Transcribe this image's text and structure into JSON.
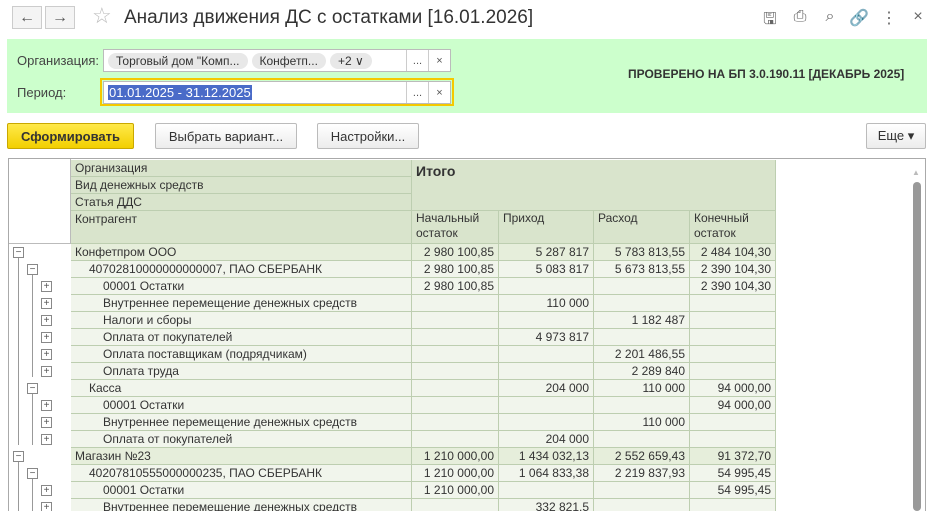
{
  "window": {
    "title": "Анализ движения ДС с остатками [16.01.2026]"
  },
  "filters": {
    "org_label": "Организация:",
    "org_chips": [
      "Торговый дом \"Комп...",
      "Конфетп...",
      "+2 ∨"
    ],
    "period_label": "Период:",
    "period_value": "01.01.2025 - 31.12.2025",
    "select_btn": "...",
    "clear_btn": "×",
    "notice": "ПРОВЕРЕНО НА БП 3.0.190.11 [ДЕКАБРЬ 2025]"
  },
  "toolbar": {
    "generate": "Сформировать",
    "choose_variant": "Выбрать вариант...",
    "settings": "Настройки...",
    "more": "Еще ▾"
  },
  "report": {
    "group_headers": [
      "Организация",
      "Вид денежных средств",
      "Статья ДДС",
      "Контрагент"
    ],
    "total_header": "Итого",
    "columns": [
      "Начальный остаток",
      "Приход",
      "Расход",
      "Конечный остаток"
    ],
    "rows": [
      {
        "level": 0,
        "name": "Конфетпром ООО",
        "v": [
          "2 980 100,85",
          "5 287 817",
          "5 783 813,55",
          "2 484 104,30"
        ]
      },
      {
        "level": 1,
        "name": "40702810000000000007, ПАО СБЕРБАНК",
        "v": [
          "2 980 100,85",
          "5 083 817",
          "5 673 813,55",
          "2 390 104,30"
        ]
      },
      {
        "level": 2,
        "name": "00001 Остатки",
        "v": [
          "2 980 100,85",
          "",
          "",
          "2 390 104,30"
        ]
      },
      {
        "level": 2,
        "name": "Внутреннее перемещение денежных средств",
        "v": [
          "",
          "110 000",
          "",
          ""
        ]
      },
      {
        "level": 2,
        "name": "Налоги и сборы",
        "v": [
          "",
          "",
          "1 182 487",
          ""
        ]
      },
      {
        "level": 2,
        "name": "Оплата от покупателей",
        "v": [
          "",
          "4 973 817",
          "",
          ""
        ]
      },
      {
        "level": 2,
        "name": "Оплата поставщикам (подрядчикам)",
        "v": [
          "",
          "",
          "2 201 486,55",
          ""
        ]
      },
      {
        "level": 2,
        "name": "Оплата труда",
        "v": [
          "",
          "",
          "2 289 840",
          ""
        ]
      },
      {
        "level": 1,
        "name": "Касса",
        "v": [
          "",
          "204 000",
          "110 000",
          "94 000,00"
        ]
      },
      {
        "level": 2,
        "name": "00001 Остатки",
        "v": [
          "",
          "",
          "",
          "94 000,00"
        ]
      },
      {
        "level": 2,
        "name": "Внутреннее перемещение денежных средств",
        "v": [
          "",
          "",
          "110 000",
          ""
        ]
      },
      {
        "level": 2,
        "name": "Оплата от покупателей",
        "v": [
          "",
          "204 000",
          "",
          ""
        ]
      },
      {
        "level": 0,
        "name": "Магазин №23",
        "v": [
          "1 210 000,00",
          "1 434 032,13",
          "2 552 659,43",
          "91 372,70"
        ]
      },
      {
        "level": 1,
        "name": "40207810555000000235, ПАО СБЕРБАНК",
        "v": [
          "1 210 000,00",
          "1 064 833,38",
          "2 219 837,93",
          "54 995,45"
        ]
      },
      {
        "level": 2,
        "name": "00001 Остатки",
        "v": [
          "1 210 000,00",
          "",
          "",
          "54 995,45"
        ]
      },
      {
        "level": 2,
        "name": "Внутреннее перемещение денежных средств",
        "v": [
          "",
          "332 821,5",
          "",
          ""
        ]
      }
    ]
  }
}
